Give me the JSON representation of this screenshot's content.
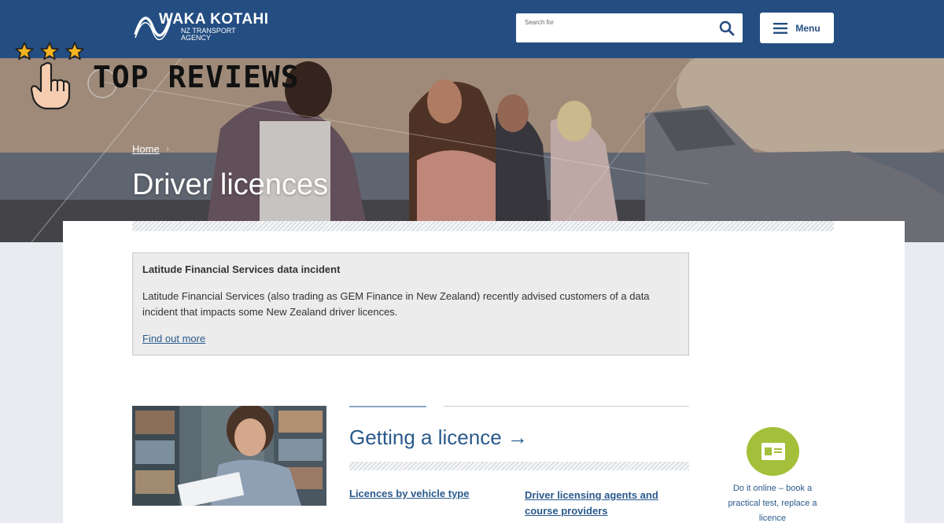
{
  "header": {
    "logo_main": "WAKA KOTAHI",
    "logo_sub_line1": "NZ TRANSPORT",
    "logo_sub_line2": "AGENCY",
    "search_placeholder": "Search for",
    "menu_label": "Menu"
  },
  "promo": {
    "text": "TOP REVIEWS",
    "stars": 3
  },
  "hero": {
    "breadcrumb": "Home",
    "breadcrumb_sep": "›",
    "title": "Driver licences"
  },
  "alert": {
    "title": "Latitude Financial Services data incident",
    "body": "Latitude Financial Services (also trading as GEM Finance in New Zealand) recently advised customers of a data incident that impacts some New Zealand driver licences.",
    "link": "Find out more"
  },
  "section": {
    "title": "Getting a licence →",
    "links": [
      "Licences by vehicle type",
      "Driver licensing agents and course providers"
    ]
  },
  "online": {
    "text": "Do it online – book a practical test, replace a licence"
  },
  "colors": {
    "header_bg": "#244e82",
    "link": "#2a5a8c",
    "online_icon": "#a4bf3a"
  }
}
